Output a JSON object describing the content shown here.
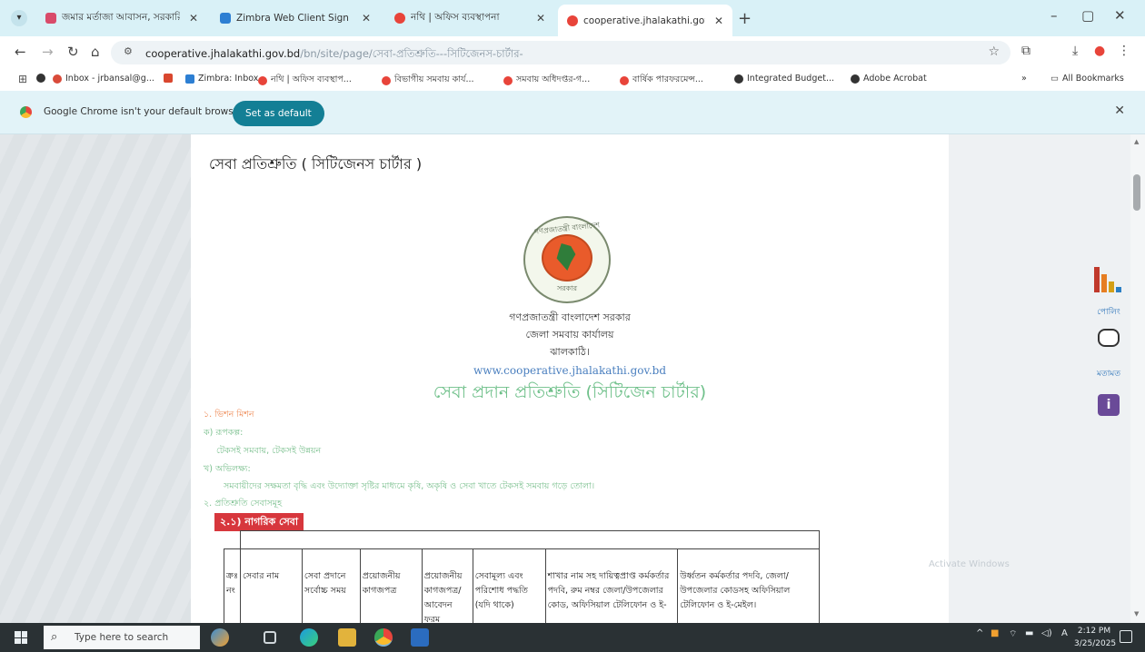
{
  "browser": {
    "tabs": [
      {
        "title": "জমার মর্তাজা আবাসন, সরকারি",
        "favicon_color": "#d94b6a",
        "active": false
      },
      {
        "title": "Zimbra Web Client Sign In",
        "favicon_color": "#2d7fd3",
        "active": false
      },
      {
        "title": "নথি | অফিস ব্যবস্থাপনা",
        "favicon_color": "#e8443a",
        "active": false
      },
      {
        "title": "cooperative.jhalakathi.gov.bd",
        "favicon_color": "#e8443a",
        "active": true
      }
    ],
    "new_tab_symbol": "+",
    "window_controls": {
      "minimize": "–",
      "maximize": "▢",
      "close": "✕"
    },
    "url_host": "cooperative.jhalakathi.gov.bd",
    "url_path": "/bn/site/page/সেবা-প্রতিশ্রুতি---সিটিজেনস-চার্টার-",
    "bookmarks": [
      {
        "label": "Inbox - jrbansal@g...",
        "color": "#d94b3a"
      },
      {
        "label": "",
        "color": "#d9472f"
      },
      {
        "label": "Zimbra: Inbox",
        "color": "#2d7fd3"
      },
      {
        "label": "নথি | অফিস ব্যবস্থাপ...",
        "color": "#e8443a"
      },
      {
        "label": "বিভাগীয় সমবায় কার্য...",
        "color": "#e8443a"
      },
      {
        "label": "সমবায় অধিদপ্তর-গ...",
        "color": "#e8443a"
      },
      {
        "label": "বার্ষিক পারফরমেন্স...",
        "color": "#e8443a"
      },
      {
        "label": "Integrated Budget...",
        "color": "#333333"
      },
      {
        "label": "Adobe Acrobat",
        "color": "#333333"
      }
    ],
    "more_bookmarks": "»",
    "all_bookmarks": "All Bookmarks",
    "infobar": {
      "message": "Google Chrome isn't your default browser",
      "button_label": "Set as default"
    }
  },
  "page": {
    "heading": "সেবা প্রতিশ্রুতি ( সিটিজেনস চার্টার )",
    "emblem": {
      "top_text": "গণপ্রজাতন্ত্রী বাংলাদেশ",
      "bottom_text": "সরকার"
    },
    "org_line1": "গণপ্রজাতন্ত্রী বাংলাদেশ সরকার",
    "org_line2": "জেলা সমবায় কার্যালয়",
    "org_line3": "ঝালকাঠি।",
    "website": "www.cooperative.jhalakathi.gov.bd",
    "charter_title": "সেবা প্রদান প্রতিশ্রুতি (সিটিজেন চার্টার)",
    "section_1": "১. ভিশন মিশন",
    "vision_label": "ক) রূপকল্প:",
    "vision_text": "টেকসই সমবায়, টেকসই উন্নয়ন",
    "mission_label": "খ) অভিলক্ষ্য:",
    "mission_text": "সমবায়ীদের সক্ষমতা বৃদ্ধি এবং উদ্যোক্তা সৃষ্টির মাধ্যমে কৃষি, অকৃষি ও সেবা খাতে টেকসই সমবায় গড়ে তোলা।",
    "section_2": "২. প্রতিশ্রুতি সেবাসমূহ",
    "civic_label": "২.১) নাগরিক সেবা",
    "table_headers": [
      "ক্রঃ নং",
      "সেবার নাম",
      "সেবা প্রদানে সর্বোচ্চ সময়",
      "প্রয়োজনীয় কাগজপত্র",
      "প্রয়োজনীয় কাগজপত্র/ আবেদন ফরম",
      "সেবামূল্য এবং পরিশোধ পদ্ধতি (যদি থাকে)",
      "শাখার নাম সহ দায়িত্বপ্রাপ্ত কর্মকর্তার পদবি, রুম নম্বর জেলা/উপজেলার কোড, অফিসিয়াল টেলিফোন ও ই-",
      "উর্ধ্বতন কর্মকর্তার পদবি, জেলা/ উপজেলার কোডসহ অফিসিয়াল টেলিফোন ও ই-মেইল।"
    ]
  },
  "sidepanel": {
    "poll_label": "পোলিং",
    "feedback_label": "মতামত",
    "info_symbol": "i"
  },
  "watermark": "Activate Windows",
  "taskbar": {
    "search_placeholder": "Type here to search",
    "time": "2:12 PM",
    "date": "3/25/2025"
  },
  "colors": {
    "tabstrip": "#d9f1f7",
    "set_default_button": "#137f95",
    "charter_title_green": "#6fc08a",
    "section_orange": "#ee8a55",
    "civic_label_red": "#d7373d",
    "website_blue": "#4a7fbf"
  }
}
